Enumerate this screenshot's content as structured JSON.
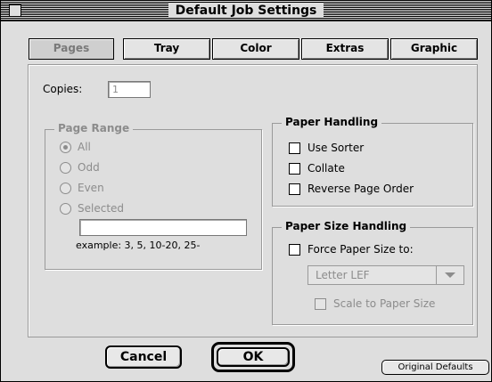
{
  "window": {
    "title": "Default Job Settings"
  },
  "tabs": [
    {
      "label": "Pages",
      "selected": true
    },
    {
      "label": "Tray",
      "selected": false
    },
    {
      "label": "Color",
      "selected": false
    },
    {
      "label": "Extras",
      "selected": false
    },
    {
      "label": "Graphic",
      "selected": false
    }
  ],
  "copies": {
    "label": "Copies:",
    "value": "1"
  },
  "page_range": {
    "title": "Page Range",
    "options": [
      {
        "label": "All",
        "selected": true
      },
      {
        "label": "Odd",
        "selected": false
      },
      {
        "label": "Even",
        "selected": false
      },
      {
        "label": "Selected",
        "selected": false
      }
    ],
    "input_value": "",
    "example": "example: 3, 5, 10-20, 25-"
  },
  "paper_handling": {
    "title": "Paper Handling",
    "options": [
      {
        "label": "Use Sorter",
        "checked": false
      },
      {
        "label": "Collate",
        "checked": false
      },
      {
        "label": "Reverse Page Order",
        "checked": false
      }
    ]
  },
  "paper_size_handling": {
    "title": "Paper Size Handling",
    "force_label": "Force Paper Size to:",
    "force_checked": false,
    "paper_size_value": "Letter LEF",
    "scale_label": "Scale to Paper Size",
    "scale_checked": false
  },
  "buttons": {
    "cancel": "Cancel",
    "ok": "OK",
    "original_defaults": "Original Defaults"
  }
}
